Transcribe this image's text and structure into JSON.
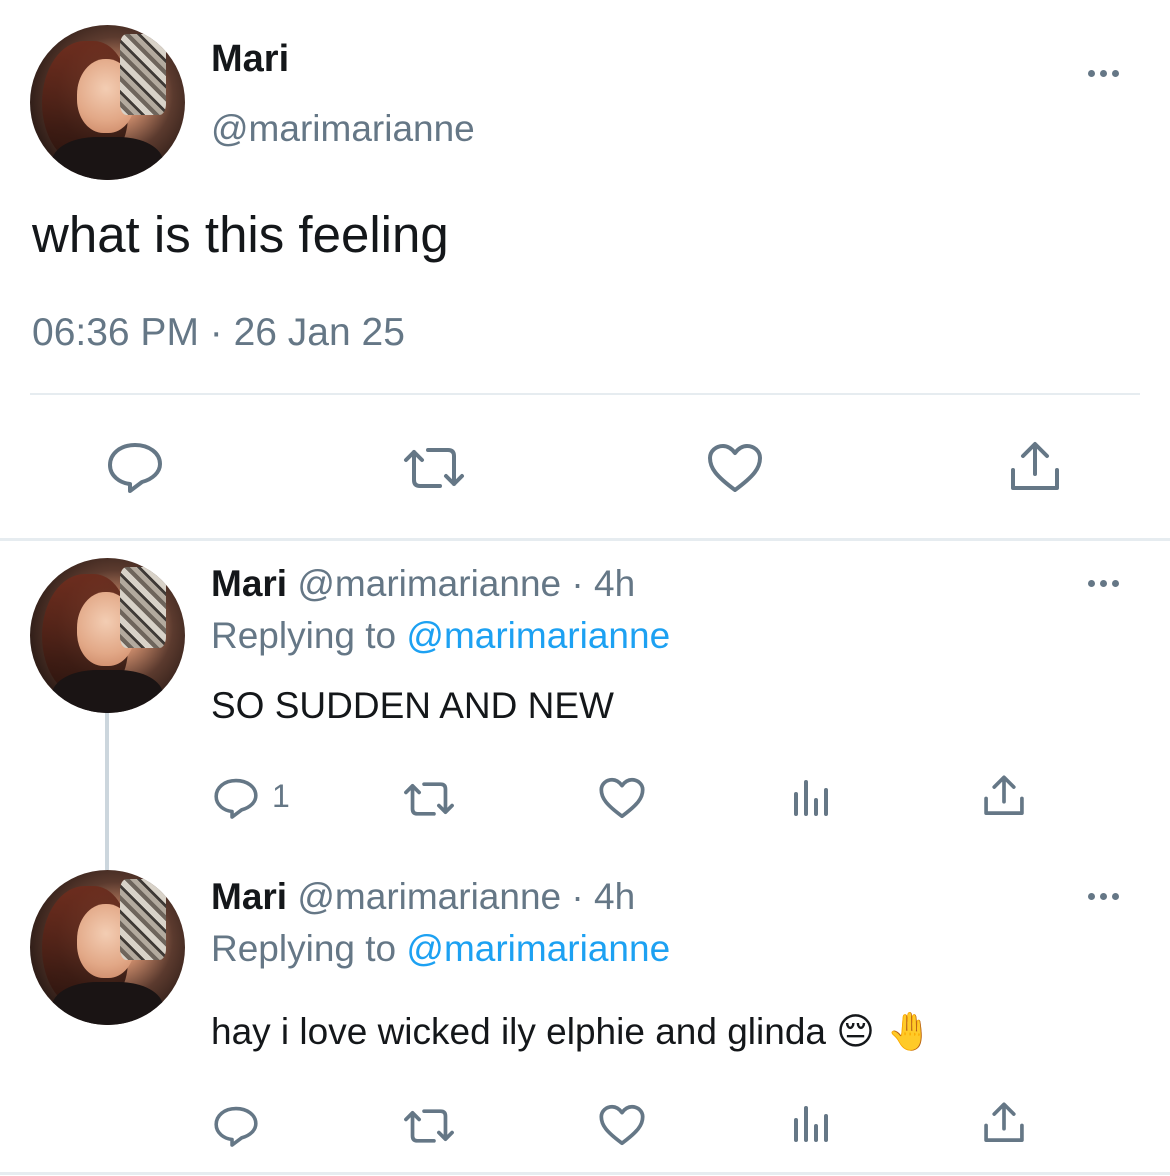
{
  "main_tweet": {
    "display_name": "Mari",
    "handle": "@marimarianne",
    "text": "what is this feeling",
    "timestamp": "06:36 PM · 26 Jan 25",
    "actions": [
      "reply-icon",
      "retweet-icon",
      "like-icon",
      "share-icon"
    ]
  },
  "replies": [
    {
      "display_name": "Mari",
      "meta": "@marimarianne · 4h",
      "replying_prefix": "Replying to",
      "replying_handle": "@marimarianne",
      "text": "SO SUDDEN AND NEW",
      "reply_count": "1"
    },
    {
      "display_name": "Mari",
      "meta": "@marimarianne · 4h",
      "replying_prefix": "Replying to",
      "replying_handle": "@marimarianne",
      "text": "hay i love wicked ily elphie and glinda",
      "emoji": "😔 🤚",
      "reply_count": ""
    }
  ],
  "colors": {
    "text": "#14171a",
    "muted": "#657786",
    "link": "#1da1f2",
    "divider": "#e6ecf0"
  }
}
